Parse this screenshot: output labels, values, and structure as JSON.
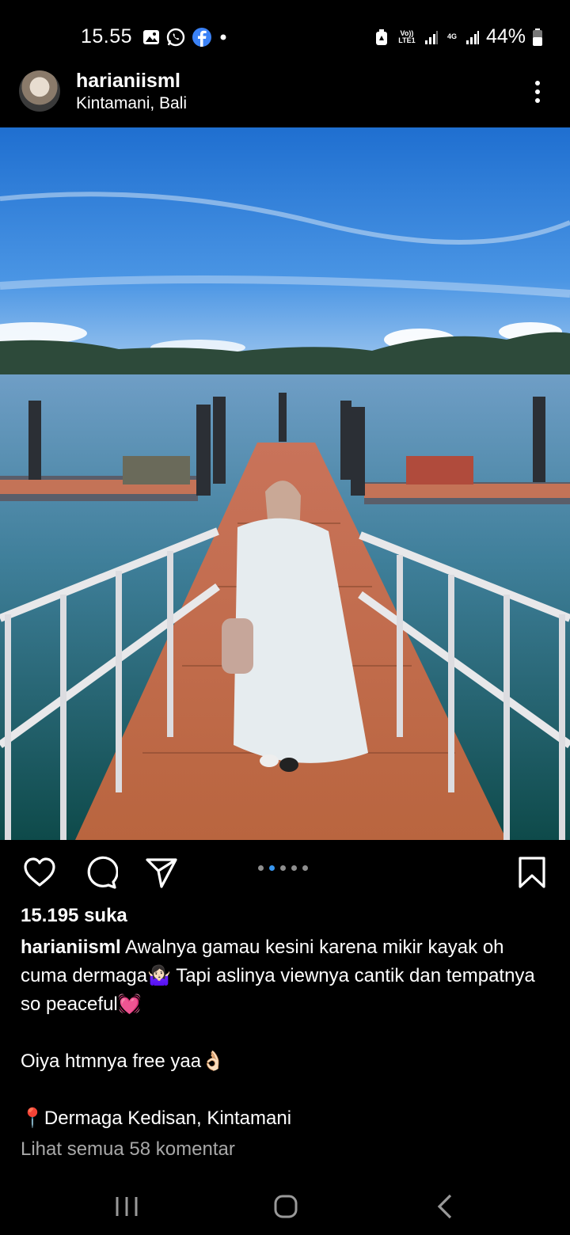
{
  "status_bar": {
    "time": "15.55",
    "battery": "44%",
    "network_1": "Vo)) LTE1",
    "network_2": "4G",
    "left_icons": [
      "gallery-icon",
      "whatsapp-icon",
      "facebook-icon",
      "dot-icon"
    ],
    "right_icons": [
      "data-saver-icon",
      "volte-icon",
      "signal-icon",
      "signal-icon",
      "battery-icon"
    ]
  },
  "post": {
    "username": "harianiisml",
    "location": "Kintamani, Bali",
    "likes": "15.195 suka",
    "caption_user": "harianiisml",
    "caption_text": " Awalnya gamau kesini karena mikir kayak oh cuma dermaga🤷🏻‍♀️ Tapi aslinya viewnya cantik dan tempatnya so peaceful💓\n\nOiya htmnya free yaa👌🏻\n\n📍Dermaga Kedisan, Kintamani",
    "comments_link": "Lihat semua 58 komentar",
    "carousel": {
      "count": 5,
      "active": 1
    }
  },
  "actions": [
    "like-icon",
    "comment-icon",
    "share-icon",
    "save-icon"
  ],
  "navbar": [
    "recent-apps-icon",
    "home-icon",
    "back-icon"
  ],
  "colors": {
    "background": "#000000",
    "text": "#ffffff",
    "muted": "#a8a8a8",
    "carousel_active": "#3897f0",
    "carousel_inactive": "#8e8e8e"
  }
}
